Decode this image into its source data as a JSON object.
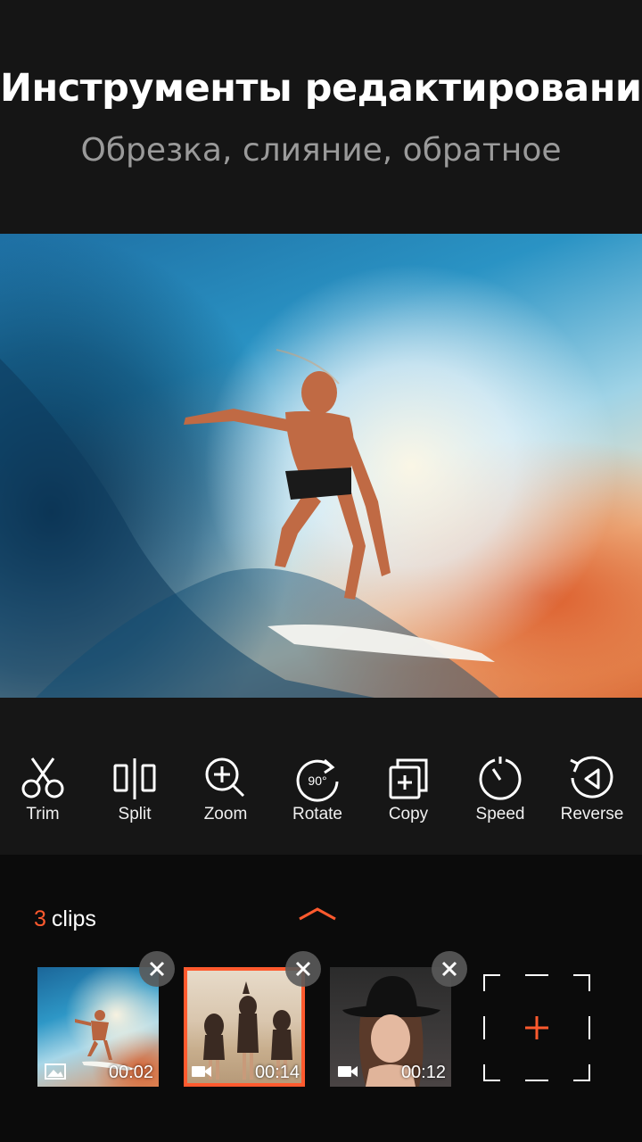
{
  "header": {
    "title": "Инструменты редактирования",
    "subtitle": "Обрезка, слияние, обратное"
  },
  "tools": [
    {
      "label": "Trim",
      "icon": "scissors-icon"
    },
    {
      "label": "Split",
      "icon": "split-icon"
    },
    {
      "label": "Zoom",
      "icon": "zoom-in-icon"
    },
    {
      "label": "Rotate",
      "icon": "rotate-icon",
      "icon_text": "90°"
    },
    {
      "label": "Copy",
      "icon": "copy-icon"
    },
    {
      "label": "Speed",
      "icon": "speed-icon"
    },
    {
      "label": "Reverse",
      "icon": "reverse-icon"
    }
  ],
  "clips": {
    "count": "3",
    "count_label": "clips",
    "items": [
      {
        "duration": "00:02",
        "type": "image",
        "type_icon": "image-icon",
        "selected": false
      },
      {
        "duration": "00:14",
        "type": "video",
        "type_icon": "video-camera-icon",
        "selected": true
      },
      {
        "duration": "00:12",
        "type": "video",
        "type_icon": "video-camera-icon",
        "selected": false
      }
    ]
  },
  "colors": {
    "accent": "#ff5a2e",
    "header_bg": "#151515",
    "toolbar_bg": "#161616",
    "clips_bg": "#0b0b0b",
    "subtitle": "#9a9a9a"
  }
}
